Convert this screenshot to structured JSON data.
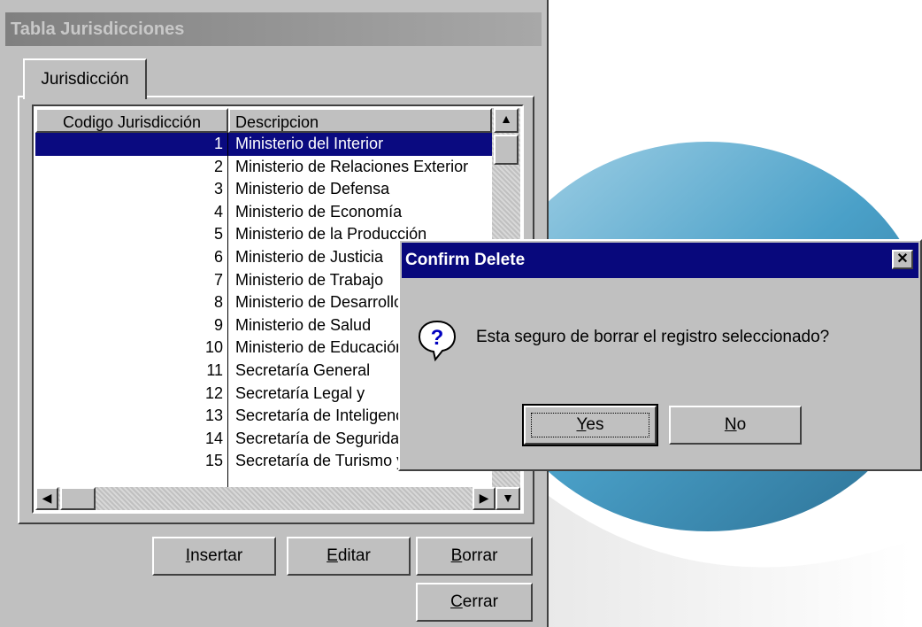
{
  "window": {
    "title": "Tabla Jurisdicciones"
  },
  "tab": {
    "label": "Jurisdicción"
  },
  "grid": {
    "columns": [
      "Codigo Jurisdicción",
      "Descripcion"
    ],
    "rows": [
      {
        "code": "1",
        "desc": "Ministerio del Interior"
      },
      {
        "code": "2",
        "desc": "Ministerio de Relaciones Exterior"
      },
      {
        "code": "3",
        "desc": "Ministerio de Defensa"
      },
      {
        "code": "4",
        "desc": "Ministerio de Economía"
      },
      {
        "code": "5",
        "desc": "Ministerio de la Producción"
      },
      {
        "code": "6",
        "desc": "Ministerio de Justicia"
      },
      {
        "code": "7",
        "desc": "Ministerio de Trabajo"
      },
      {
        "code": "8",
        "desc": "Ministerio de Desarrollo"
      },
      {
        "code": "9",
        "desc": "Ministerio de Salud"
      },
      {
        "code": "10",
        "desc": "Ministerio de Educación"
      },
      {
        "code": "11",
        "desc": "Secretaría General"
      },
      {
        "code": "12",
        "desc": "Secretaría Legal y"
      },
      {
        "code": "13",
        "desc": "Secretaría de Inteligencia"
      },
      {
        "code": "14",
        "desc": "Secretaría de Seguridad"
      },
      {
        "code": "15",
        "desc": "Secretaría de Turismo y Deporte"
      }
    ]
  },
  "buttons": {
    "insertar": {
      "key": "I",
      "rest": "nsertar"
    },
    "editar": {
      "key": "E",
      "rest": "ditar"
    },
    "borrar": {
      "key": "B",
      "rest": "orrar"
    },
    "cerrar": {
      "key": "C",
      "rest": "errar"
    }
  },
  "dialog": {
    "title": "Confirm Delete",
    "message": "Esta seguro de borrar el registro seleccionado?",
    "yes": {
      "key": "Y",
      "rest": "es"
    },
    "no": {
      "key": "N",
      "rest": "o"
    },
    "close_glyph": "✕"
  },
  "icons": [
    "question-icon",
    "close-icon",
    "scroll-up-icon",
    "scroll-down-icon",
    "scroll-left-icon",
    "scroll-right-icon"
  ],
  "colors": {
    "selection": "#0a0a80",
    "dialog_title": "#08087c"
  }
}
